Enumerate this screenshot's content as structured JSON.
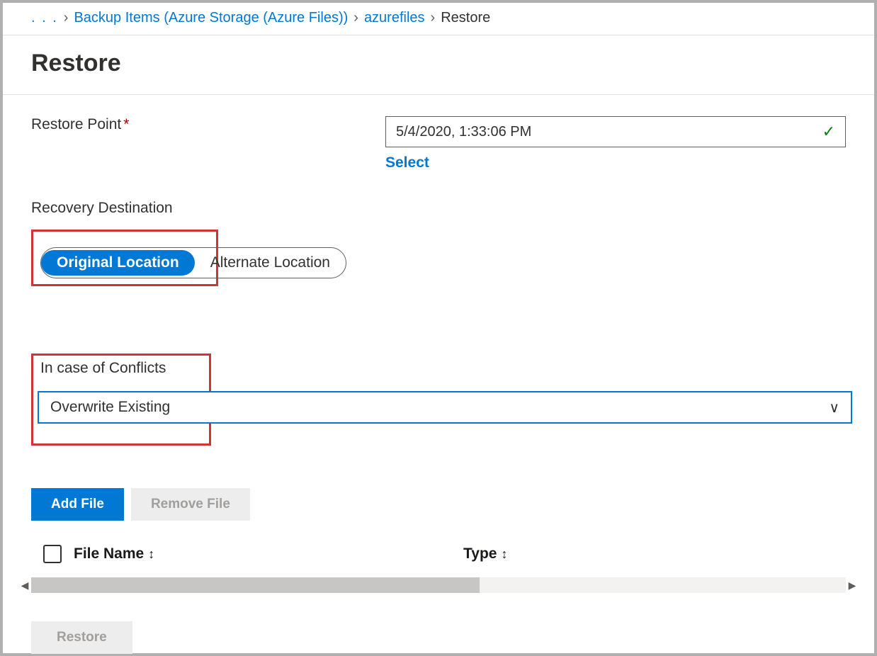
{
  "breadcrumb": {
    "ellipsis": ". . .",
    "item1": "Backup Items (Azure Storage (Azure Files))",
    "item2": "azurefiles",
    "current": "Restore"
  },
  "title": "Restore",
  "restorePoint": {
    "label": "Restore Point",
    "value": "5/4/2020, 1:33:06 PM",
    "selectLink": "Select"
  },
  "recoveryDestination": {
    "label": "Recovery Destination",
    "option1": "Original Location",
    "option2": "Alternate Location"
  },
  "conflicts": {
    "label": "In case of Conflicts",
    "value": "Overwrite Existing"
  },
  "buttons": {
    "addFile": "Add File",
    "removeFile": "Remove File"
  },
  "table": {
    "col1": "File Name",
    "col2": "Type"
  },
  "footer": {
    "restore": "Restore"
  }
}
